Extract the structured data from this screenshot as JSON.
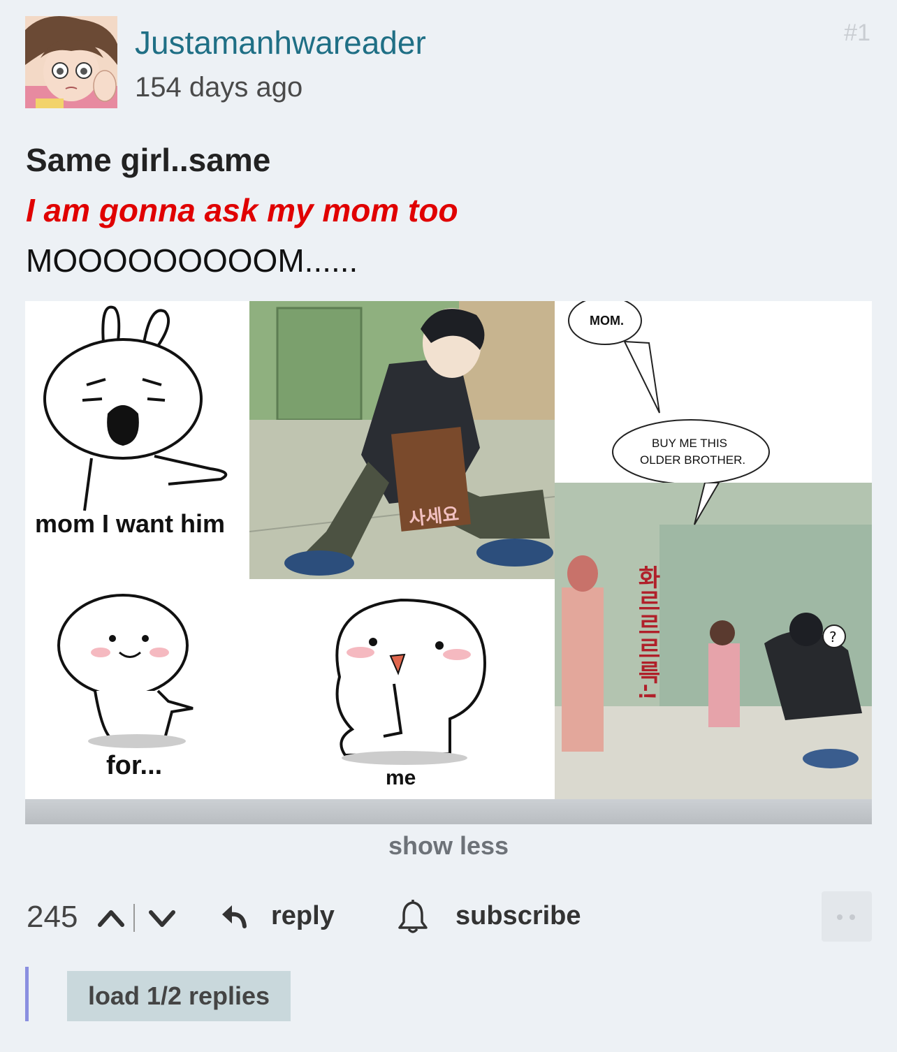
{
  "comment": {
    "username": "Justamanhwareader",
    "timestamp": "154 days ago",
    "post_number": "#1",
    "lines": [
      "Same girl..same",
      "I am gonna ask my mom too",
      "MOOOOOOOOOM......"
    ],
    "highlight_color": "#e00000"
  },
  "image": {
    "captions": {
      "panel1": "mom I want him",
      "panel2": "for...",
      "panel3": "me"
    },
    "bubbles": {
      "mom": "MOM.",
      "buy_line1": "BUY ME THIS",
      "buy_line2": "OLDER BROTHER."
    },
    "sign_text": "사세요",
    "sfx_text": "화르르르륵-!"
  },
  "show_less_label": "show less",
  "actions": {
    "score": "245",
    "reply_label": "reply",
    "subscribe_label": "subscribe"
  },
  "load_replies_label": "load 1/2 replies",
  "colors": {
    "background": "#edf1f5",
    "username": "#1f6f85",
    "thread_line": "#8a8fe0",
    "load_button_bg": "#c9d8dc"
  },
  "icons": [
    "avatar",
    "upvote-icon",
    "downvote-icon",
    "reply-arrow-icon",
    "bell-icon",
    "more-dots-icon"
  ]
}
